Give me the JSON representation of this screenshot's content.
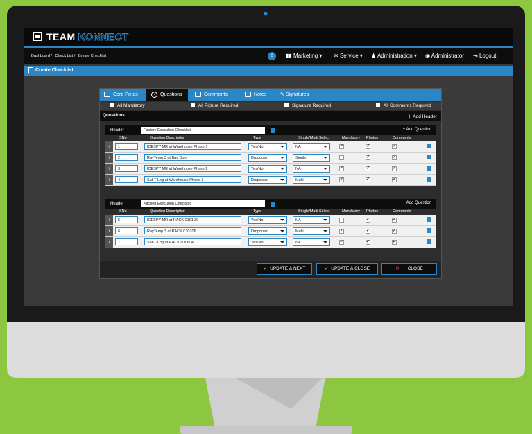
{
  "brand": {
    "part1": "TEAM",
    "part2": "KONNECT"
  },
  "breadcrumb": [
    "Dashboard /",
    "Check List /",
    "Create Checklist"
  ],
  "nav": {
    "badge": "0",
    "marketing": "Marketing",
    "service": "Service",
    "administration": "Administration",
    "user": "Administrator",
    "logout": "Logout"
  },
  "page_title": "Create Checklist",
  "tabs": [
    "Core Fields",
    "Questions",
    "Comments",
    "Notes",
    "Signatures"
  ],
  "options": [
    "All Mandatory",
    "All Picture Required",
    "Signature Required",
    "All Comments Required"
  ],
  "questions_label": "Questions",
  "add_header": "Add Header",
  "add_question": "Add Question",
  "header_label": "Header",
  "columns": [
    "SNo",
    "Question Description",
    "Type",
    "Single/Multi Select",
    "Mandatory",
    "Photos",
    "Comments"
  ],
  "sections": [
    {
      "header": "Factory Execution Checklist",
      "rows": [
        {
          "sno": "1",
          "desc": "ICESPY MR at Warehouse Phase 1",
          "type": "Yes/No",
          "select": "NA",
          "mandatory": true,
          "photos": true,
          "comments": true
        },
        {
          "sno": "2",
          "desc": "RayTemp 3 at Bay Door",
          "type": "Dropdown",
          "select": "Single",
          "mandatory": false,
          "photos": true,
          "comments": true
        },
        {
          "sno": "3",
          "desc": "ICESPY MR at Warehouse Phase 2",
          "type": "Yes/No",
          "select": "NA",
          "mandatory": true,
          "photos": true,
          "comments": true
        },
        {
          "sno": "4",
          "desc": "Saf-T-Log at Warehouse Phase 3",
          "type": "Dropdown",
          "select": "Multi",
          "mandatory": true,
          "photos": true,
          "comments": true
        }
      ]
    },
    {
      "header": "Kitchen Execution Checklist",
      "rows": [
        {
          "sno": "5",
          "desc": "ICESPY MR at RACK 010106",
          "type": "Yes/No",
          "select": "NA",
          "mandatory": false,
          "photos": true,
          "comments": true
        },
        {
          "sno": "6",
          "desc": "RayTemp 3 at RACK 030106",
          "type": "Dropdown",
          "select": "Multi",
          "mandatory": true,
          "photos": true,
          "comments": true
        },
        {
          "sno": "7",
          "desc": "Saf-T-Log at RACK 010604",
          "type": "Yes/No",
          "select": "NA",
          "mandatory": true,
          "photos": true,
          "comments": true
        }
      ]
    }
  ],
  "buttons": {
    "update_next": "UPDATE & NEXT",
    "update_close": "UPDATE & CLOSE",
    "close": "CLOSE"
  },
  "colors": {
    "accent": "#2b86c5",
    "background": "#8dc63f",
    "dark": "#0d0d0d",
    "check_green": "#8dc63f",
    "close_red": "#e03030"
  }
}
